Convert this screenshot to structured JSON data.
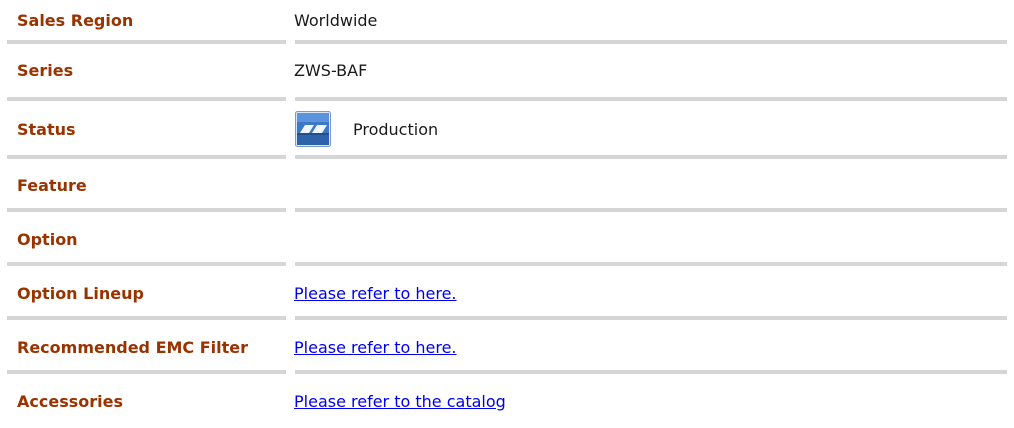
{
  "rows": [
    {
      "label": "Sales Region",
      "value": "Worldwide"
    },
    {
      "label": "Series",
      "value": "ZWS-BAF"
    },
    {
      "label": "Status",
      "value": "Production",
      "icon": "production-status-icon"
    },
    {
      "label": "Feature",
      "value": ""
    },
    {
      "label": "Option",
      "value": ""
    },
    {
      "label": "Option Lineup",
      "link": "Please refer to here."
    },
    {
      "label": "Recommended EMC Filter",
      "link": "Please refer to here."
    },
    {
      "label": "Accessories",
      "link": "Please refer to the catalog"
    }
  ],
  "colors": {
    "label": "#993300",
    "link": "#0000ee",
    "separator": "#d6d6d6",
    "icon_blue": "#3a78c8"
  }
}
